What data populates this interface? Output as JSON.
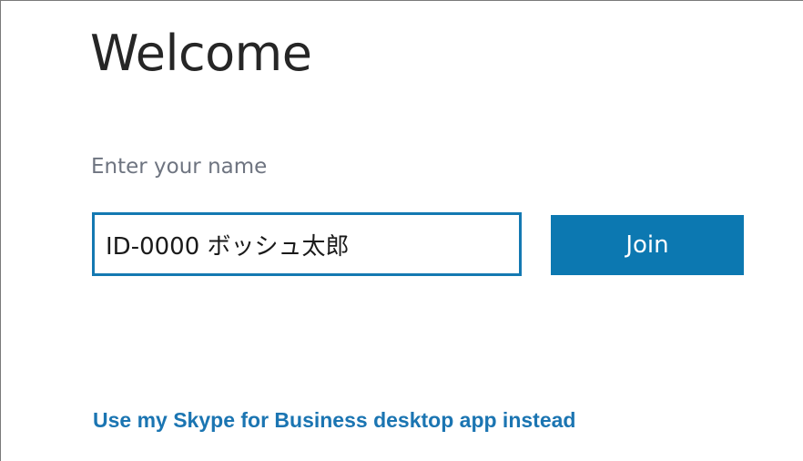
{
  "page": {
    "title": "Welcome"
  },
  "form": {
    "name_label": "Enter your name",
    "name_value": "ID-0000 ボッシュ太郎",
    "join_label": "Join"
  },
  "footer": {
    "desktop_link": "Use my Skype for Business desktop app instead"
  },
  "colors": {
    "accent": "#0c78b1",
    "link": "#1b75b2",
    "input_border": "#1479b2",
    "label": "#6e7480",
    "title": "#262626"
  }
}
